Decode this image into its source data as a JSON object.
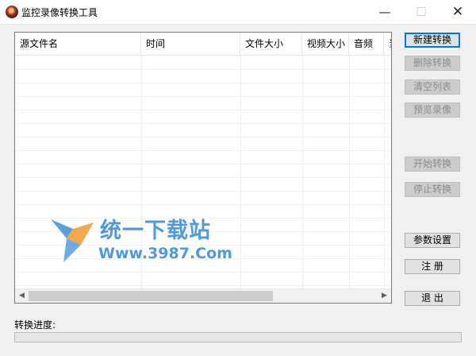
{
  "window": {
    "title": "监控录像转换工具",
    "minimize_glyph": "—",
    "maximize_glyph": "☐",
    "close_glyph": "✕"
  },
  "list": {
    "columns": [
      "源文件名",
      "时间",
      "文件大小",
      "视频大小",
      "音频",
      "当"
    ],
    "rows": []
  },
  "buttons": {
    "new": "新建转换",
    "delete": "删除转换",
    "clear": "清空列表",
    "preview": "预览录像",
    "start": "开始转换",
    "stop": "停止转换",
    "settings": "参数设置",
    "register": "注 册",
    "exit": "退 出"
  },
  "progress": {
    "label": "转换进度:",
    "value": 0
  },
  "watermark": {
    "title": "统一下载站",
    "url": "Www.3987.Com"
  },
  "colors": {
    "accent": "#0078d7",
    "watermark": "#3f8fd8",
    "progress_fill": "#06b025"
  }
}
